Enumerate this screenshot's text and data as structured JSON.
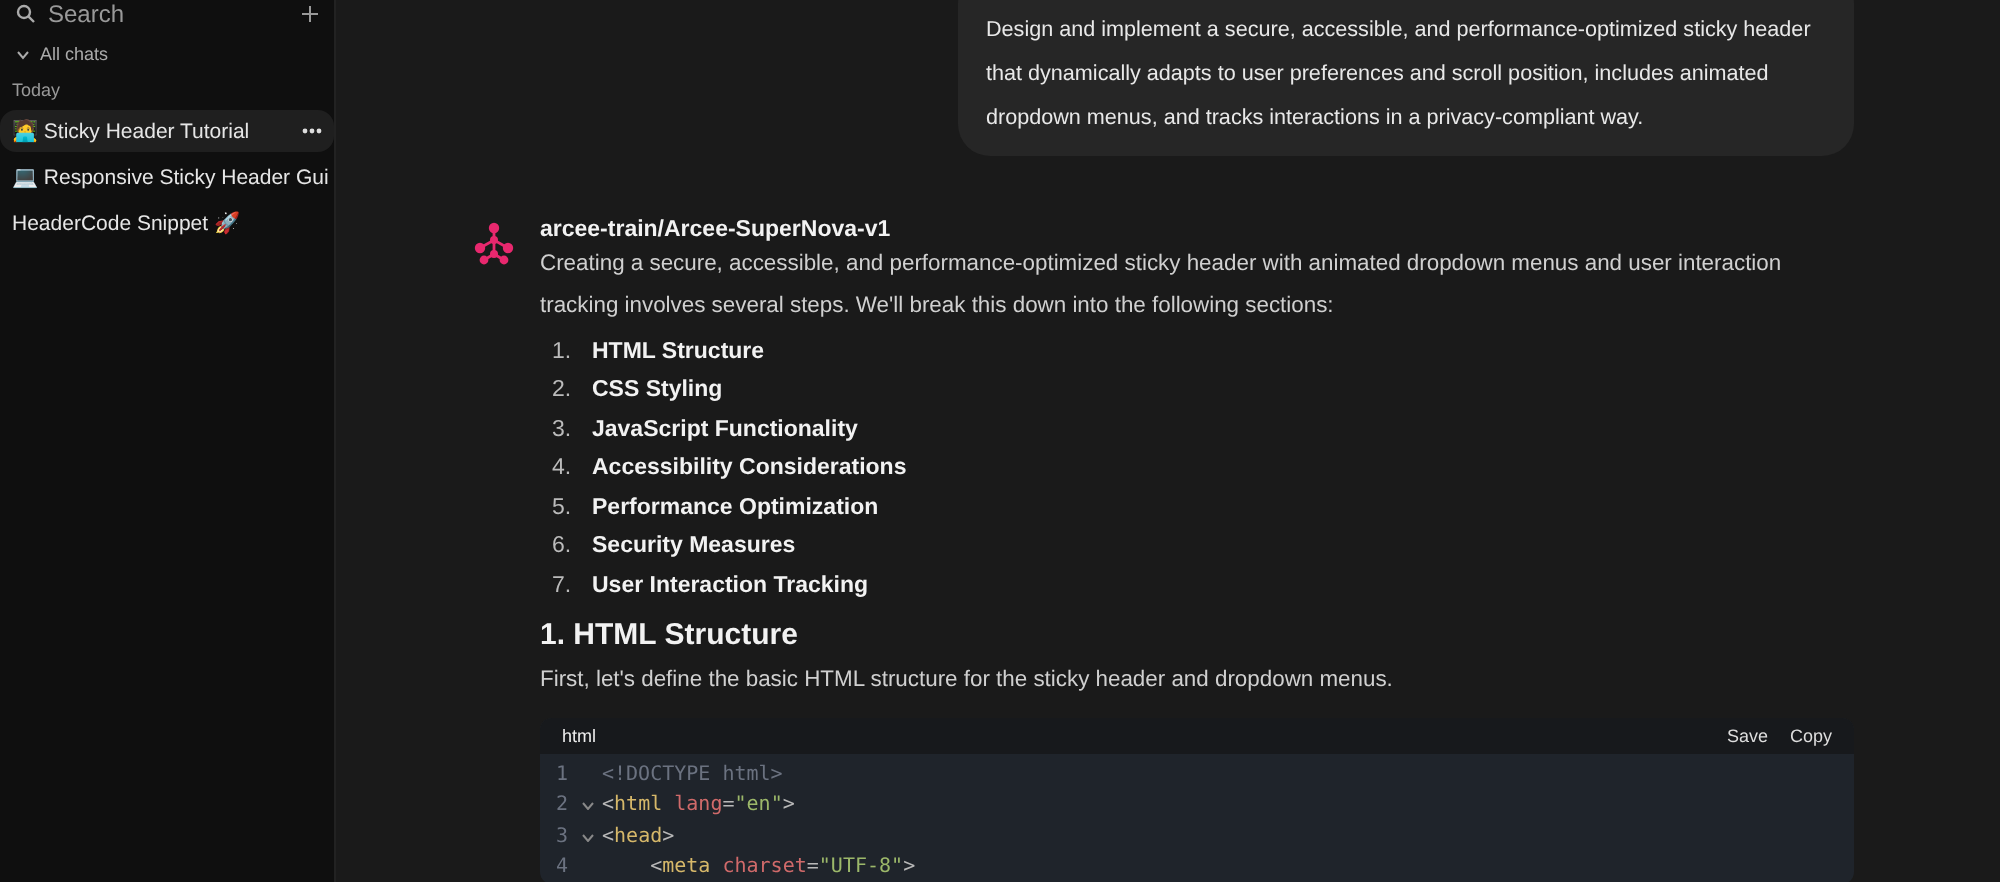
{
  "sidebar": {
    "search": {
      "placeholder": "Search"
    },
    "section": "All chats",
    "group": "Today",
    "chats": [
      {
        "title": "🧑‍💻 Sticky Header Tutorial",
        "selected": true
      },
      {
        "title": "💻 Responsive Sticky Header Gui",
        "selected": false
      },
      {
        "title": "HeaderCode Snippet 🚀",
        "selected": false
      }
    ]
  },
  "user_message": "Design and implement a secure, accessible, and performance-optimized sticky header that dynamically adapts to user preferences and scroll position, includes animated dropdown menus, and tracks interactions in a privacy-compliant way.",
  "reply": {
    "model": "arcee-train/Arcee-SuperNova-v1",
    "intro": "Creating a secure, accessible, and performance-optimized sticky header with animated dropdown menus and user interaction tracking involves several steps. We'll break this down into the following sections:",
    "steps": [
      {
        "num": "1.",
        "text": "HTML Structure"
      },
      {
        "num": "2.",
        "text": "CSS Styling"
      },
      {
        "num": "3.",
        "text": "JavaScript Functionality"
      },
      {
        "num": "4.",
        "text": "Accessibility Considerations"
      },
      {
        "num": "5.",
        "text": "Performance Optimization"
      },
      {
        "num": "6.",
        "text": "Security Measures"
      },
      {
        "num": "7.",
        "text": "User Interaction Tracking"
      }
    ],
    "heading": "1. HTML Structure",
    "paragraph": "First, let's define the basic HTML structure for the sticky header and dropdown menus.",
    "code": {
      "language": "html",
      "actions": [
        "Save",
        "Copy"
      ],
      "lines": [
        {
          "num": "1",
          "foldable": false,
          "tokens": [
            {
              "kind": "comment",
              "text": "<!DOCTYPE html>"
            }
          ]
        },
        {
          "num": "2",
          "foldable": true,
          "tokens": [
            {
              "kind": "punct",
              "text": "<"
            },
            {
              "kind": "tag",
              "text": "html"
            },
            {
              "kind": "attr",
              "text": " lang"
            },
            {
              "kind": "punct",
              "text": "="
            },
            {
              "kind": "string",
              "text": "\"en\""
            },
            {
              "kind": "punct",
              "text": ">"
            }
          ]
        },
        {
          "num": "3",
          "foldable": true,
          "tokens": [
            {
              "kind": "punct",
              "text": "<"
            },
            {
              "kind": "tag",
              "text": "head"
            },
            {
              "kind": "punct",
              "text": ">"
            }
          ]
        },
        {
          "num": "4",
          "foldable": false,
          "tokens": [
            {
              "kind": "punct",
              "text": "    <"
            },
            {
              "kind": "tag",
              "text": "meta"
            },
            {
              "kind": "attr",
              "text": " charset"
            },
            {
              "kind": "punct",
              "text": "="
            },
            {
              "kind": "string",
              "text": "\"UTF-8\""
            },
            {
              "kind": "punct",
              "text": ">"
            }
          ]
        }
      ]
    }
  }
}
